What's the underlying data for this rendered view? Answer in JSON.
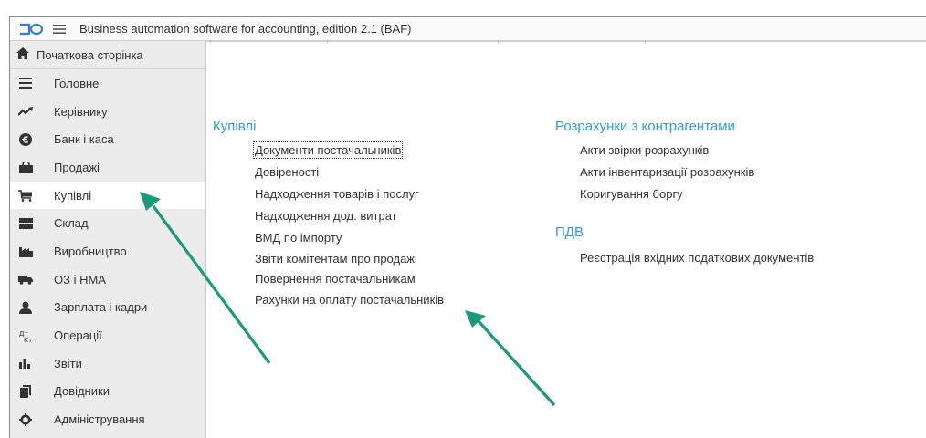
{
  "window": {
    "title": "Business automation software for accounting, edition 2.1  (BAF)",
    "logo_icon": "app-logo-icon",
    "menu_icon": "hamburger-menu-icon"
  },
  "sidebar": {
    "home": {
      "label": "Початкова сторінка",
      "icon": "home-icon"
    },
    "items": [
      {
        "label": "Головне",
        "icon": "list-icon"
      },
      {
        "label": "Керівнику",
        "icon": "trend-icon"
      },
      {
        "label": "Банк і каса",
        "icon": "coin-icon"
      },
      {
        "label": "Продажі",
        "icon": "shop-icon"
      },
      {
        "label": "Купівлі",
        "icon": "cart-icon",
        "active": true
      },
      {
        "label": "Склад",
        "icon": "warehouse-icon"
      },
      {
        "label": "Виробництво",
        "icon": "factory-icon"
      },
      {
        "label": "ОЗ і НМА",
        "icon": "truck-icon"
      },
      {
        "label": "Зарплата і кадри",
        "icon": "person-icon"
      },
      {
        "label": "Операції",
        "icon": "operations-icon"
      },
      {
        "label": "Звіти",
        "icon": "bar-chart-icon"
      },
      {
        "label": "Довідники",
        "icon": "books-icon"
      },
      {
        "label": "Адміністрування",
        "icon": "gear-icon"
      }
    ]
  },
  "main": {
    "purchases": {
      "title": "Купівлі",
      "links": [
        "Документи постачальників",
        "Довіреності",
        "Надходження товарів і послуг",
        "Надходження дод. витрат",
        "ВМД по імпорту",
        "Звіти комітентам про продажі",
        "Повернення постачальникам",
        "Рахунки на оплату постачальників"
      ]
    },
    "settlements": {
      "title": "Розрахунки з контрагентами",
      "links": [
        "Акти звірки розрахунків",
        "Акти інвентаризації розрахунків",
        "Коригування боргу"
      ]
    },
    "vat": {
      "title": "ПДВ",
      "links": [
        "Реєстрація вхідних податкових документів"
      ]
    }
  },
  "colors": {
    "section_title": "#2d9ed8",
    "arrow": "#1a9a7c",
    "sidebar_bg": "#ececec"
  }
}
